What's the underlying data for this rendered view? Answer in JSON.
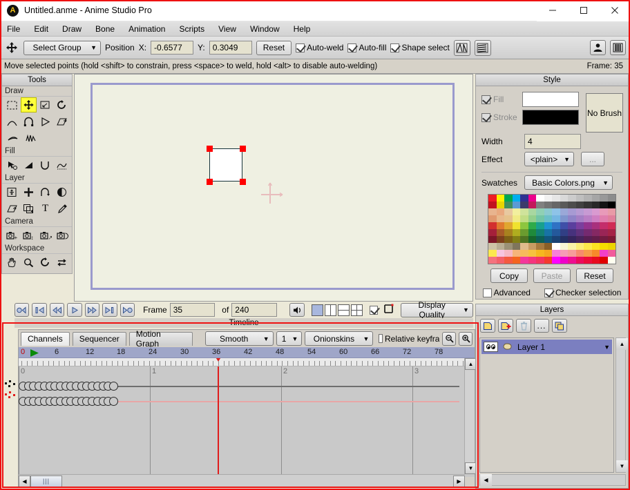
{
  "window": {
    "title": "Untitled.anme - Anime Studio Pro",
    "logo_icon": "app-logo-icon",
    "minimize": "minimize-icon",
    "maximize": "maximize-icon",
    "close": "close-icon"
  },
  "menu": {
    "items": [
      "File",
      "Edit",
      "Draw",
      "Bone",
      "Animation",
      "Scripts",
      "View",
      "Window",
      "Help"
    ]
  },
  "toolbar": {
    "move_icon": "move-tool-icon",
    "tool_select": "Select Group",
    "position_label": "Position",
    "x_label": "X:",
    "x_value": "-0.6577",
    "y_label": "Y:",
    "y_value": "0.3049",
    "reset_label": "Reset",
    "auto_weld": "Auto-weld",
    "auto_fill": "Auto-fill",
    "shape_select": "Shape select",
    "auto_weld_checked": true,
    "auto_fill_checked": true,
    "shape_select_checked": true,
    "icon1": "flip-horizontal-icon",
    "icon2": "flip-vertical-icon",
    "icon_right1": "character-icon",
    "icon_right2": "library-icon"
  },
  "status": {
    "message": "Move selected points (hold <shift> to constrain, press <space> to weld, hold <alt> to disable auto-welding)",
    "frame": "Frame: 35"
  },
  "tools_panel": {
    "title": "Tools",
    "groups": [
      {
        "label": "Draw",
        "tools": [
          {
            "name": "select-points-icon",
            "glyph": "▫"
          },
          {
            "name": "transform-points-icon",
            "glyph": "✥",
            "selected": true
          },
          {
            "name": "scale-points-icon",
            "glyph": "◱"
          },
          {
            "name": "rotate-points-icon",
            "glyph": "↻"
          },
          {
            "name": "add-point-icon",
            "glyph": "◠"
          },
          {
            "name": "magnet-icon",
            "glyph": "∩"
          },
          {
            "name": "shape-icon",
            "glyph": "▷"
          },
          {
            "name": "perspective-points-icon",
            "glyph": "▱"
          },
          {
            "name": "curvature-icon",
            "glyph": "⌒"
          },
          {
            "name": "noise-icon",
            "glyph": "∿"
          }
        ]
      },
      {
        "label": "Fill",
        "tools": [
          {
            "name": "select-shape-icon",
            "glyph": "↖"
          },
          {
            "name": "create-shape-icon",
            "glyph": "◢"
          },
          {
            "name": "line-width-icon",
            "glyph": "∪"
          },
          {
            "name": "hide-edge-icon",
            "glyph": "◠"
          }
        ]
      },
      {
        "label": "Layer",
        "tools": [
          {
            "name": "translate-layer-icon",
            "glyph": "✥"
          },
          {
            "name": "scale-layer-icon",
            "glyph": "✚"
          },
          {
            "name": "rotate-layer-z-icon",
            "glyph": "↷"
          },
          {
            "name": "rotate-layer-xy-icon",
            "glyph": "◑"
          },
          {
            "name": "shear-layer-icon",
            "glyph": "▱"
          },
          {
            "name": "set-origin-icon",
            "glyph": "⬓"
          },
          {
            "name": "text-tool-icon",
            "glyph": "T"
          },
          {
            "name": "eyedropper-icon",
            "glyph": "✎"
          }
        ]
      },
      {
        "label": "Camera",
        "tools": [
          {
            "name": "track-camera-icon",
            "glyph": "📷"
          },
          {
            "name": "zoom-camera-icon",
            "glyph": "📷"
          },
          {
            "name": "roll-camera-icon",
            "glyph": "📷"
          },
          {
            "name": "pan-tilt-camera-icon",
            "glyph": "📷"
          }
        ]
      },
      {
        "label": "Workspace",
        "tools": [
          {
            "name": "pan-workspace-icon",
            "glyph": "✋"
          },
          {
            "name": "zoom-workspace-icon",
            "glyph": "🔍"
          },
          {
            "name": "rotate-workspace-icon",
            "glyph": "↻"
          },
          {
            "name": "orbit-workspace-icon",
            "glyph": "⇄"
          }
        ]
      }
    ]
  },
  "canvas": {
    "background_color": "#eff0e2",
    "border_color": "#9a9acd",
    "shape_fill": "#ffffff",
    "shape_stroke": "#16333a",
    "handle_color": "#ff0000",
    "origin_icon": "origin-crosshair-icon"
  },
  "playback": {
    "buttons": [
      {
        "name": "rewind-to-start-button",
        "glyph": "◁|"
      },
      {
        "name": "previous-keyframe-button",
        "glyph": "|◁"
      },
      {
        "name": "step-back-button",
        "glyph": "◁◁"
      },
      {
        "name": "play-button",
        "glyph": "▷"
      },
      {
        "name": "step-forward-button",
        "glyph": "▷▷"
      },
      {
        "name": "next-keyframe-button",
        "glyph": "▷|"
      },
      {
        "name": "go-to-end-button",
        "glyph": "▷◯"
      }
    ],
    "frame_label": "Frame",
    "frame_value": "35",
    "of_label": "of",
    "total_frames": "240",
    "audio_icon": "speaker-icon",
    "view_single": "view-single-icon",
    "view_split_v": "view-split-vertical-icon",
    "view_split_h": "view-split-horizontal-icon",
    "view_quad": "view-quad-icon",
    "toggle_checked": true,
    "bounds_icon": "bounds-icon",
    "display_quality": "Display Quality"
  },
  "timeline": {
    "title": "Timeline",
    "tabs": [
      {
        "label": "Channels",
        "selected": true
      },
      {
        "label": "Sequencer",
        "selected": false
      },
      {
        "label": "Motion Graph",
        "selected": false
      }
    ],
    "interpolation": "Smooth",
    "step": "1",
    "onionskins": "Onionskins",
    "relative_keyframes_label": "Relative keyfra",
    "relative_keyframes_checked": false,
    "zoom_out_icon": "zoom-out-icon",
    "zoom_in_icon": "zoom-in-icon",
    "ruler_ticks": [
      "0",
      "6",
      "12",
      "18",
      "24",
      "30",
      "36",
      "42",
      "48",
      "54",
      "60",
      "66",
      "72",
      "78"
    ],
    "second_marks": [
      "0",
      "1",
      "2",
      "3"
    ],
    "playhead_frame": 35,
    "playhead_label": "36",
    "start_marker_icon": "start-marker-icon",
    "keyframe_rows": [
      {
        "name": "layer-keyframe-row",
        "count": 18,
        "line_color": "#6e6e6e"
      },
      {
        "name": "point-keyframe-row",
        "count": 18,
        "line_color": "#e8a6a6"
      }
    ],
    "gutter_icons": [
      "black-points-icon",
      "red-points-icon"
    ],
    "scroll_left_icon": "scroll-left-icon",
    "scroll_right_icon": "scroll-right-icon",
    "scroll_up_icon": "scroll-up-icon",
    "scroll_down_icon": "scroll-down-icon"
  },
  "style": {
    "title": "Style",
    "fill_label": "Fill",
    "fill_checked": true,
    "fill_color": "#ffffff",
    "stroke_label": "Stroke",
    "stroke_checked": true,
    "stroke_color": "#000000",
    "no_brush_label": "No Brush",
    "width_label": "Width",
    "width_value": "4",
    "effect_label": "Effect",
    "effect_value": "<plain>",
    "effect_more": "...",
    "swatches_label": "Swatches",
    "swatches_value": "Basic Colors.png",
    "copy_label": "Copy",
    "paste_label": "Paste",
    "paste_disabled": true,
    "reset_label": "Reset",
    "advanced_label": "Advanced",
    "advanced_checked": false,
    "checker_label": "Checker selection",
    "checker_checked": true,
    "palette": [
      [
        "#ee1c25",
        "#fff200",
        "#00a651",
        "#00aeef",
        "#2e3192",
        "#ec008c",
        "#ffffff",
        "#f1f1f1",
        "#e6e6e6",
        "#d9d9d9",
        "#cccccc",
        "#bfbfbf",
        "#b3b3b3",
        "#a6a6a6",
        "#999999",
        "#8c8c8c"
      ],
      [
        "#c1121f",
        "#e8d500",
        "#3f8f5e",
        "#5b9bd5",
        "#3b3b6b",
        "#c2185b",
        "#808080",
        "#737373",
        "#676767",
        "#5a5a5a",
        "#4d4d4d",
        "#414141",
        "#343434",
        "#282828",
        "#141414",
        "#000000"
      ],
      [
        "#e8b48e",
        "#e9a97e",
        "#e8c9a0",
        "#f2ef9e",
        "#cfe39b",
        "#a8d7a0",
        "#8fd0b4",
        "#8bc9cf",
        "#8ec3e8",
        "#9aa8d8",
        "#a79ad3",
        "#b79ad3",
        "#c79ad3",
        "#d99ad0",
        "#e89ab9",
        "#e89aa6"
      ],
      [
        "#e09a6f",
        "#e8b98c",
        "#e6c28b",
        "#f0ea85",
        "#c2dd85",
        "#93cf8c",
        "#73c5a6",
        "#6bbfc8",
        "#74b6e2",
        "#7f96ce",
        "#8f83c7",
        "#a57fc5",
        "#b97fc5",
        "#cf7fc2",
        "#e07fae",
        "#e07f9b"
      ],
      [
        "#d32f2f",
        "#e07a2f",
        "#e0a62f",
        "#f0e22f",
        "#8dc63f",
        "#2eab4a",
        "#18a08e",
        "#1f93d1",
        "#2f72c4",
        "#3f4fa8",
        "#5a3f9e",
        "#7a3f9e",
        "#93338e",
        "#a8307d",
        "#c42e6b",
        "#d02b55"
      ],
      [
        "#a5203a",
        "#a85b28",
        "#a8821f",
        "#b0ad1f",
        "#6b9b2f",
        "#1f8a3a",
        "#128073",
        "#1873a5",
        "#24599b",
        "#313f85",
        "#47327d",
        "#60327d",
        "#752a70",
        "#852863",
        "#9a2556",
        "#a52346"
      ],
      [
        "#7d1628",
        "#7d401c",
        "#7d6016",
        "#827f16",
        "#4f7322",
        "#16662b",
        "#0d5f55",
        "#11567d",
        "#1a4274",
        "#242f63",
        "#35255d",
        "#47255d",
        "#581f53",
        "#631d4a",
        "#731b40",
        "#7d1934"
      ],
      [
        "#cec3a6",
        "#b9ae93",
        "#9b9176",
        "#7f755c",
        "#e0bb8c",
        "#c99c63",
        "#a87a3e",
        "#8a5f28",
        "#ffffff",
        "#faf5d5",
        "#fbf3a8",
        "#fcee76",
        "#fce94a",
        "#fbe321",
        "#f7dc00",
        "#ecd400"
      ],
      [
        "#fce94f",
        "#f7c5e0",
        "#f7b8c4",
        "#f6b47a",
        "#f6bb5c",
        "#f6c23f",
        "#f6b81f",
        "#f5a81f",
        "#f780d8",
        "#f79bb6",
        "#f79b9b",
        "#f78a6e",
        "#f79b4a",
        "#f78a2a",
        "#f23fc7",
        "#f25b9b"
      ],
      [
        "#f4727e",
        "#f4606a",
        "#f45a3f",
        "#f4641f",
        "#f4379b",
        "#f4357e",
        "#f4355f",
        "#f43a2e",
        "#ff00ff",
        "#ef00c9",
        "#ee0f90",
        "#ec0b5c",
        "#ec0b3a",
        "#e80b1f",
        "#e00000",
        "#fffff0"
      ]
    ]
  },
  "layers": {
    "title": "Layers",
    "buttons": [
      {
        "name": "new-layer-button",
        "glyph": "▤"
      },
      {
        "name": "add-layer-button",
        "glyph": "▤"
      },
      {
        "name": "delete-layer-button",
        "glyph": "🗑"
      },
      {
        "name": "layer-settings-button",
        "glyph": "..."
      },
      {
        "name": "duplicate-layer-button",
        "glyph": "❐"
      }
    ],
    "rows": [
      {
        "name": "Layer 1",
        "visible": true,
        "type_icon": "vector-layer-icon"
      }
    ]
  }
}
